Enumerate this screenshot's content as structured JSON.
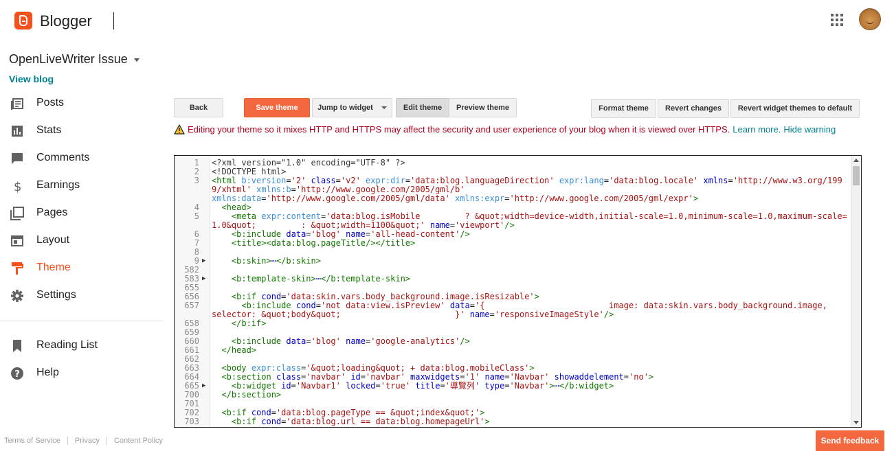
{
  "header": {
    "brand": "Blogger"
  },
  "blog": {
    "name": "OpenLiveWriter Issue",
    "view_blog": "View blog"
  },
  "nav": [
    {
      "label": "Posts",
      "icon": "posts-icon",
      "active": false
    },
    {
      "label": "Stats",
      "icon": "stats-icon",
      "active": false
    },
    {
      "label": "Comments",
      "icon": "comments-icon",
      "active": false
    },
    {
      "label": "Earnings",
      "icon": "earnings-icon",
      "active": false
    },
    {
      "label": "Pages",
      "icon": "pages-icon",
      "active": false
    },
    {
      "label": "Layout",
      "icon": "layout-icon",
      "active": false
    },
    {
      "label": "Theme",
      "icon": "theme-icon",
      "active": true
    },
    {
      "label": "Settings",
      "icon": "settings-icon",
      "active": false
    }
  ],
  "nav_secondary": [
    {
      "label": "Reading List",
      "icon": "bookmark-icon"
    },
    {
      "label": "Help",
      "icon": "help-icon"
    }
  ],
  "footer": {
    "terms": "Terms of Service",
    "privacy": "Privacy",
    "content_policy": "Content Policy"
  },
  "toolbar": {
    "back": "Back",
    "save": "Save theme",
    "jump": "Jump to widget",
    "edit": "Edit theme",
    "preview": "Preview theme",
    "format": "Format theme",
    "revert": "Revert changes",
    "revert_widgets": "Revert widget themes to default"
  },
  "warning": {
    "text": "Editing your theme so it mixes HTTP and HTTPS may affect the security and user experience of your blog when it is viewed over HTTPS.",
    "learn_more": "Learn more.",
    "hide": "Hide warning"
  },
  "feedback": "Send feedback",
  "colors": {
    "accent": "#f4511e",
    "link": "#00838f",
    "warning": "#b00020"
  },
  "code_lines": [
    {
      "n": "1",
      "fold": false,
      "html": "<span class=\"c\">&lt;?xml version=\"1.0\" encoding=\"UTF-8\" ?&gt;</span>"
    },
    {
      "n": "2",
      "fold": false,
      "html": "<span class=\"c\">&lt;!DOCTYPE html&gt;</span>"
    },
    {
      "n": "3",
      "fold": false,
      "html": "<span class=\"t\">&lt;html</span> <span class=\"at\">b:version</span>=<span class=\"s\">'2'</span> <span class=\"a\">class</span>=<span class=\"s\">'v2'</span> <span class=\"at\">expr:dir</span>=<span class=\"s\">'data:blog.languageDirection'</span> <span class=\"at\">expr:lang</span>=<span class=\"s\">'data:blog.locale'</span> <span class=\"a\">xmlns</span>=<span class=\"s\">'http://www.w3.org/1999/xhtml'</span> <span class=\"at\">xmlns:b</span>=<span class=\"s\">'http://www.google.com/2005/gml/b'</span>\n<span class=\"at\">xmlns:data</span>=<span class=\"s\">'http://www.google.com/2005/gml/data'</span> <span class=\"at\">xmlns:expr</span>=<span class=\"s\">'http://www.google.com/2005/gml/expr'</span><span class=\"t\">&gt;</span>"
    },
    {
      "n": "4",
      "fold": false,
      "html": "  <span class=\"t\">&lt;head&gt;</span>"
    },
    {
      "n": "5",
      "fold": false,
      "html": "    <span class=\"t\">&lt;meta</span> <span class=\"at\">expr:content</span>=<span class=\"s\">'data:blog.isMobile         ? &amp;quot;width=device-width,initial-scale=1.0,minimum-scale=1.0,maximum-scale=1.0&amp;quot;         : &amp;quot;width=1100&amp;quot;'</span> <span class=\"a\">name</span>=<span class=\"s\">'viewport'</span><span class=\"t\">/&gt;</span>"
    },
    {
      "n": "6",
      "fold": false,
      "html": "    <span class=\"t\">&lt;b:include</span> <span class=\"a\">data</span>=<span class=\"s\">'blog'</span> <span class=\"a\">name</span>=<span class=\"s\">'all-head-content'</span><span class=\"t\">/&gt;</span>"
    },
    {
      "n": "7",
      "fold": false,
      "html": "    <span class=\"t\">&lt;title&gt;</span><span class=\"t\">&lt;data:blog.pageTitle/&gt;</span><span class=\"t\">&lt;/title&gt;</span>"
    },
    {
      "n": "8",
      "fold": false,
      "html": ""
    },
    {
      "n": "9",
      "fold": true,
      "html": "    <span class=\"t\">&lt;b:skin&gt;</span><span class=\"a\">⋯</span><span class=\"t\">&lt;/b:skin&gt;</span>"
    },
    {
      "n": "582",
      "fold": false,
      "html": ""
    },
    {
      "n": "583",
      "fold": true,
      "html": "    <span class=\"t\">&lt;b:template-skin&gt;</span><span class=\"a\">⋯</span><span class=\"t\">&lt;/b:template-skin&gt;</span>"
    },
    {
      "n": "655",
      "fold": false,
      "html": ""
    },
    {
      "n": "656",
      "fold": false,
      "html": "    <span class=\"t\">&lt;b:if</span> <span class=\"a\">cond</span>=<span class=\"s\">'data:skin.vars.body_background.image.isResizable'</span><span class=\"t\">&gt;</span>"
    },
    {
      "n": "657",
      "fold": false,
      "html": "      <span class=\"t\">&lt;b:include</span> <span class=\"a\">cond</span>=<span class=\"s\">'not data:view.isPreview'</span> <span class=\"a\">data</span>=<span class=\"s\">'{                         image: data:skin.vars.body_background.image,                         selector: &amp;quot;body&amp;quot;                       }'</span> <span class=\"a\">name</span>=<span class=\"s\">'responsiveImageStyle'</span><span class=\"t\">/&gt;</span>"
    },
    {
      "n": "658",
      "fold": false,
      "html": "    <span class=\"t\">&lt;/b:if&gt;</span>"
    },
    {
      "n": "659",
      "fold": false,
      "html": ""
    },
    {
      "n": "660",
      "fold": false,
      "html": "    <span class=\"t\">&lt;b:include</span> <span class=\"a\">data</span>=<span class=\"s\">'blog'</span> <span class=\"a\">name</span>=<span class=\"s\">'google-analytics'</span><span class=\"t\">/&gt;</span>"
    },
    {
      "n": "661",
      "fold": false,
      "html": "  <span class=\"t\">&lt;/head&gt;</span>"
    },
    {
      "n": "662",
      "fold": false,
      "html": ""
    },
    {
      "n": "663",
      "fold": false,
      "html": "  <span class=\"t\">&lt;body</span> <span class=\"at\">expr:class</span>=<span class=\"s\">'&amp;quot;loading&amp;quot; + data:blog.mobileClass'</span><span class=\"t\">&gt;</span>"
    },
    {
      "n": "664",
      "fold": false,
      "html": "  <span class=\"t\">&lt;b:section</span> <span class=\"a\">class</span>=<span class=\"s\">'navbar'</span> <span class=\"a\">id</span>=<span class=\"s\">'navbar'</span> <span class=\"a\">maxwidgets</span>=<span class=\"s\">'1'</span> <span class=\"a\">name</span>=<span class=\"s\">'Navbar'</span> <span class=\"a\">showaddelement</span>=<span class=\"s\">'no'</span><span class=\"t\">&gt;</span>"
    },
    {
      "n": "665",
      "fold": true,
      "html": "    <span class=\"t\">&lt;b:widget</span> <span class=\"a\">id</span>=<span class=\"s\">'Navbar1'</span> <span class=\"a\">locked</span>=<span class=\"s\">'true'</span> <span class=\"a\">title</span>=<span class=\"s\">'導覽列'</span> <span class=\"a\">type</span>=<span class=\"s\">'Navbar'</span><span class=\"t\">&gt;</span><span class=\"a\">⋯</span><span class=\"t\">&lt;/b:widget&gt;</span>"
    },
    {
      "n": "700",
      "fold": false,
      "html": "  <span class=\"t\">&lt;/b:section&gt;</span>"
    },
    {
      "n": "701",
      "fold": false,
      "html": ""
    },
    {
      "n": "702",
      "fold": false,
      "html": "  <span class=\"t\">&lt;b:if</span> <span class=\"a\">cond</span>=<span class=\"s\">'data:blog.pageType == &amp;quot;index&amp;quot;'</span><span class=\"t\">&gt;</span>"
    },
    {
      "n": "703",
      "fold": false,
      "html": "    <span class=\"t\">&lt;b:if</span> <span class=\"a\">cond</span>=<span class=\"s\">'data:blog.url == data:blog.homepageUrl'</span><span class=\"t\">&gt;</span>"
    }
  ]
}
